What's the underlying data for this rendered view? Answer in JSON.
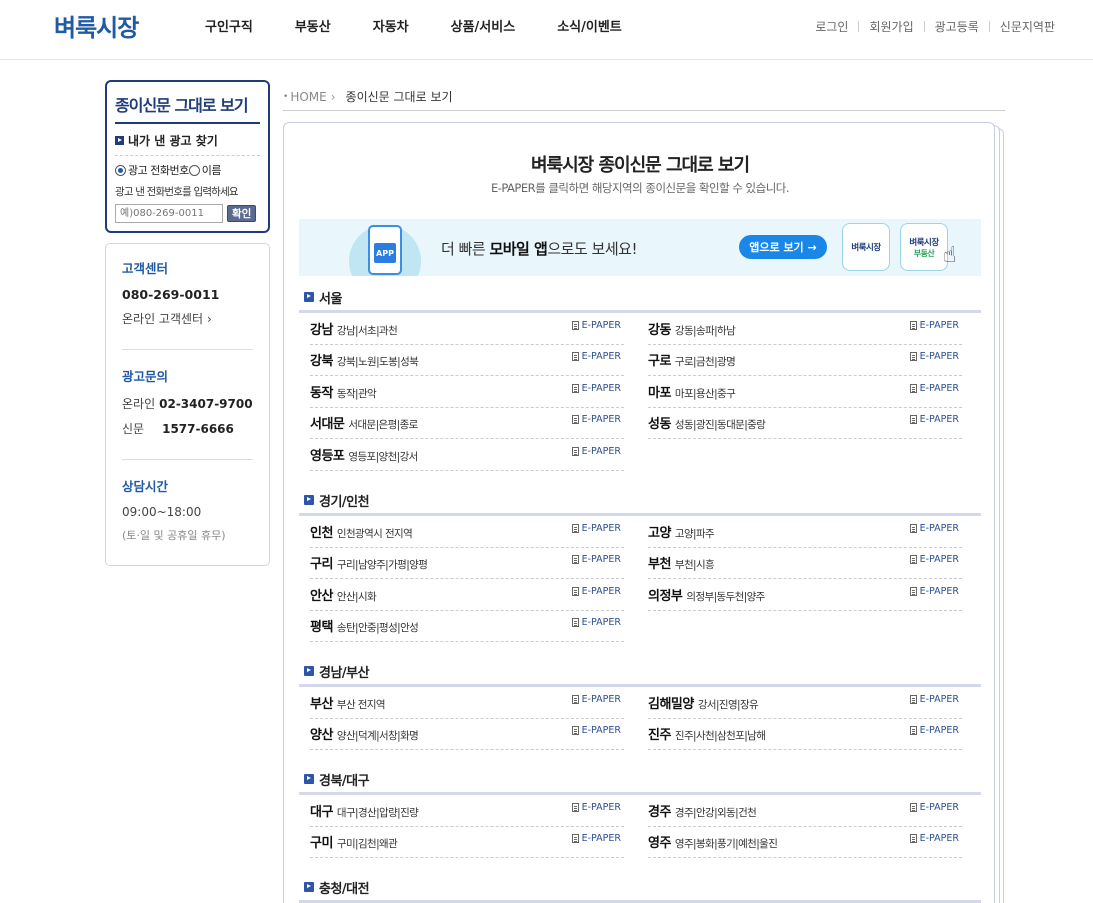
{
  "header": {
    "logo": "벼룩시장",
    "nav": [
      "구인구직",
      "부동산",
      "자동차",
      "상품/서비스",
      "소식/이벤트"
    ],
    "util": [
      "로그인",
      "회원가입",
      "광고등록",
      "신문지역판"
    ]
  },
  "search": {
    "title": "종이신문 그대로 보기",
    "find_title": "내가 낸 광고 찾기",
    "radio_phone": "광고 전화번호",
    "radio_name": "이름",
    "hint": "광고 낸 전화번호를 입력하세요",
    "input_placeholder": "예)080-269-0011",
    "ok_label": "확인"
  },
  "info": {
    "cs_title": "고객센터",
    "cs_phone": "080-269-0011",
    "cs_online": "온라인 고객센터",
    "ad_title": "광고문의",
    "ad_online_label": "온라인",
    "ad_online_phone": "02-3407-9700",
    "ad_paper_label": "신문",
    "ad_paper_phone": "1577-6666",
    "hours_title": "상담시간",
    "hours": "09:00~18:00",
    "hours_note": "(토·일 및 공휴일 휴무)"
  },
  "breadcrumb": {
    "home": "HOME",
    "current": "종이신문 그대로 보기"
  },
  "main": {
    "title": "벼룩시장 종이신문 그대로 보기",
    "subtitle": "E-PAPER를 클릭하면 해당지역의 종이신문을 확인할 수 있습니다."
  },
  "banner": {
    "app_label": "APP",
    "text_pre": "더 빠른 ",
    "text_bold": "모바일 앱",
    "text_post": "으로도 보세요!",
    "button": "앱으로 보기 →",
    "card1": "벼룩시장",
    "card2_top": "벼룩시장",
    "card2_bottom": "부동산"
  },
  "epaper_label": "E-PAPER",
  "regions": [
    {
      "name": "서울",
      "items": [
        {
          "name": "강남",
          "sub": "강남|서초|과천"
        },
        {
          "name": "강동",
          "sub": "강동|송파|하남"
        },
        {
          "name": "강북",
          "sub": "강북|노원|도봉|성북"
        },
        {
          "name": "구로",
          "sub": "구로|금천|광명"
        },
        {
          "name": "동작",
          "sub": "동작|관악"
        },
        {
          "name": "마포",
          "sub": "마포|용산|중구"
        },
        {
          "name": "서대문",
          "sub": "서대문|은평|종로"
        },
        {
          "name": "성동",
          "sub": "성동|광진|동대문|중랑"
        },
        {
          "name": "영등포",
          "sub": "영등포|양천|강서"
        }
      ]
    },
    {
      "name": "경기/인천",
      "items": [
        {
          "name": "인천",
          "sub": "인천광역시 전지역"
        },
        {
          "name": "고양",
          "sub": "고양|파주"
        },
        {
          "name": "구리",
          "sub": "구리|남양주|가평|양평"
        },
        {
          "name": "부천",
          "sub": "부천|시흥"
        },
        {
          "name": "안산",
          "sub": "안산|시화"
        },
        {
          "name": "의정부",
          "sub": "의정부|동두천|양주"
        },
        {
          "name": "평택",
          "sub": "송탄|안중|평성|안성"
        }
      ]
    },
    {
      "name": "경남/부산",
      "items": [
        {
          "name": "부산",
          "sub": "부산 전지역"
        },
        {
          "name": "김해밀양",
          "sub": "강서|진영|장유"
        },
        {
          "name": "양산",
          "sub": "양산|덕계|서창|화명"
        },
        {
          "name": "진주",
          "sub": "진주|사천|삼천포|남해"
        }
      ]
    },
    {
      "name": "경북/대구",
      "items": [
        {
          "name": "대구",
          "sub": "대구|경산|압량|진량"
        },
        {
          "name": "경주",
          "sub": "경주|안강|외동|건천"
        },
        {
          "name": "구미",
          "sub": "구미|김천|왜관"
        },
        {
          "name": "영주",
          "sub": "영주|봉화|풍기|예천|울진"
        }
      ]
    },
    {
      "name": "충청/대전",
      "items": []
    }
  ]
}
